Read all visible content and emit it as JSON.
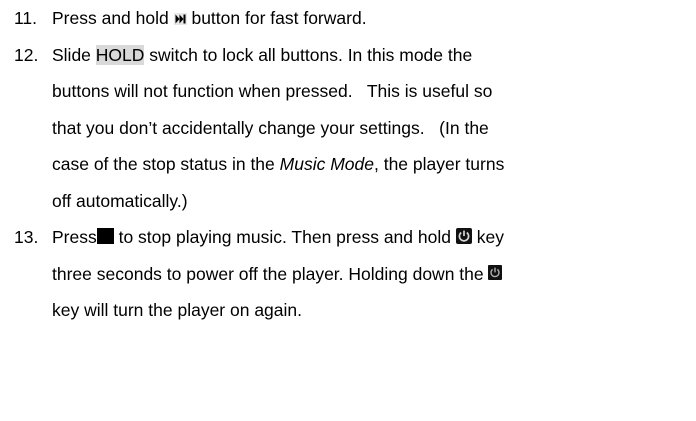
{
  "items": [
    {
      "number": "11.",
      "lines": [
        {
          "before_icon": "Press and hold ",
          "icon": "fast-forward-icon",
          "after_icon": " button for fast forward."
        }
      ]
    },
    {
      "number": "12.",
      "lines": [
        {
          "text_a": "Slide ",
          "highlight": "HOLD",
          "text_b": " switch to lock all buttons. In this mode the"
        },
        {
          "text": "buttons will not function when pressed.   This is useful so"
        },
        {
          "text": "that you don’t accidentally change your settings.   (In the"
        },
        {
          "text_a": "case of the stop status in the ",
          "italic": "Music Mode",
          "text_b": ", the player turns"
        },
        {
          "text": "off automatically.)"
        }
      ]
    },
    {
      "number": "13.",
      "lines": [
        {
          "text_a": "Press",
          "icon_a": "stop-icon",
          "text_b": " to stop playing music. Then press and hold ",
          "icon_b": "power-icon",
          "text_c": " key"
        },
        {
          "text_a": "three seconds to power off the player. Holding down the ",
          "icon": "power-icon"
        },
        {
          "text": "key will turn the player on again."
        }
      ]
    }
  ],
  "colors": {
    "text": "#000000",
    "highlight": "#d9d9d9",
    "icon": "#000000"
  }
}
